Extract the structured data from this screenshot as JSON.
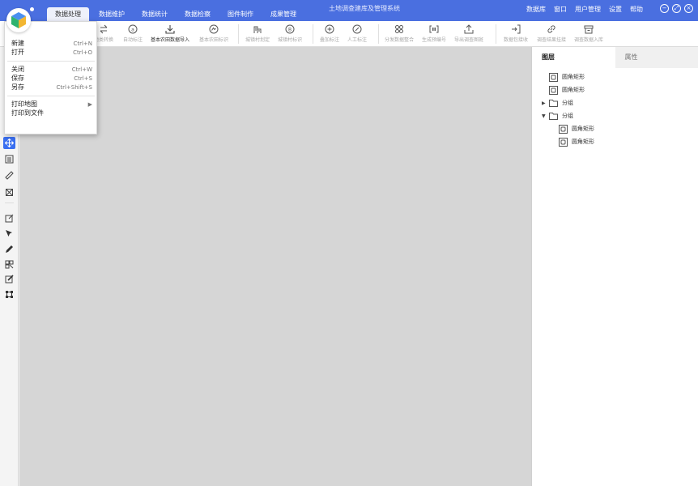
{
  "app": {
    "title": "土地调查建库及管理系统",
    "accent_color": "#4a6fe0",
    "logo_icon": "hexagon-cube-logo-icon"
  },
  "menubar": {
    "tabs": [
      "数据处理",
      "数据维护",
      "数据统计",
      "数据检察",
      "图件制作",
      "成果管理"
    ],
    "active_tab": "数据处理",
    "right_items": [
      "数据库",
      "窗口",
      "用户管理",
      "设置",
      "帮助"
    ]
  },
  "window_controls": {
    "minimize": "−",
    "restore": "⤢",
    "close": "×"
  },
  "ribbon": {
    "buttons": [
      {
        "label": "地类转换",
        "icon": "swap-arrows-icon",
        "enabled": false
      },
      {
        "label": "自动标注",
        "icon": "circle-a-icon",
        "enabled": false
      },
      {
        "label": "基本农田数据导入",
        "icon": "import-tray-icon",
        "enabled": true
      },
      {
        "label": "基本农田标识",
        "icon": "circle-mark-icon",
        "enabled": false
      },
      {
        "label": "城镇村划定",
        "icon": "building-grid-icon",
        "enabled": false
      },
      {
        "label": "城镇村标识",
        "icon": "circle-b-icon",
        "enabled": false
      },
      {
        "label": "叠加标注",
        "icon": "circle-plus-icon",
        "enabled": false
      },
      {
        "label": "人工标注",
        "icon": "circle-pen-icon",
        "enabled": false
      },
      {
        "label": "分发数据整合",
        "icon": "four-squares-icon",
        "enabled": false
      },
      {
        "label": "生成预编号",
        "icon": "bracket-number-icon",
        "enabled": false
      },
      {
        "label": "导出调查图斑",
        "icon": "export-tray-icon",
        "enabled": false
      },
      {
        "label": "数据包接收",
        "icon": "login-arrow-icon",
        "enabled": false
      },
      {
        "label": "调查结果挂接",
        "icon": "link-icon",
        "enabled": false
      },
      {
        "label": "调查数据入库",
        "icon": "archive-box-icon",
        "enabled": false
      }
    ]
  },
  "file_menu": {
    "items": [
      {
        "label": "新建",
        "shortcut": "Ctrl+N"
      },
      {
        "label": "打开",
        "shortcut": "Ctrl+O"
      },
      {
        "label": "关闭",
        "shortcut": "Ctrl+W"
      },
      {
        "label": "保存",
        "shortcut": "Ctrl+S"
      },
      {
        "label": "另存",
        "shortcut": "Ctrl+Shift+S"
      },
      {
        "label": "打印地图",
        "shortcut": "▶"
      },
      {
        "label": "打印到文件",
        "shortcut": ""
      }
    ]
  },
  "left_tools": [
    "pan-move-icon",
    "list-panel-icon",
    "ruler-icon",
    "frame-select-icon",
    "edit-box-icon",
    "arrow-select-icon",
    "pen-draw-icon",
    "grid-select-icon",
    "sketch-edit-icon",
    "node-edit-icon"
  ],
  "right_panel": {
    "tabs": [
      "图层",
      "属性"
    ],
    "active_tab": "图层",
    "layers": [
      {
        "label": "圆角矩形",
        "type": "shape",
        "indent": 0,
        "expander": ""
      },
      {
        "label": "圆角矩形",
        "type": "shape",
        "indent": 0,
        "expander": ""
      },
      {
        "label": "分组",
        "type": "folder",
        "indent": 0,
        "expander": "▶"
      },
      {
        "label": "分组",
        "type": "folder",
        "indent": 0,
        "expander": "▼"
      },
      {
        "label": "圆角矩形",
        "type": "shape",
        "indent": 1,
        "expander": ""
      },
      {
        "label": "圆角矩形",
        "type": "shape",
        "indent": 1,
        "expander": ""
      }
    ]
  }
}
